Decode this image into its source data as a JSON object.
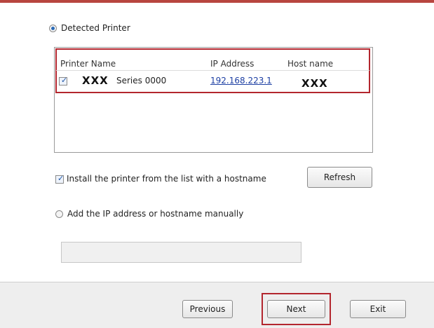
{
  "detected": {
    "label": "Detected Printer",
    "columns": {
      "name": "Printer Name",
      "ip": "IP Address",
      "host": "Host name"
    },
    "rows": [
      {
        "checked": true,
        "name_mask": "XXX",
        "series": "Series 0000",
        "ip": "192.168.223.1",
        "host": "XXX"
      }
    ]
  },
  "hostname_checkbox": {
    "checked": true,
    "label": "Install the printer from the list with a hostname"
  },
  "refresh_label": "Refresh",
  "manual": {
    "label": "Add the IP address or hostname manually",
    "value": ""
  },
  "footer": {
    "previous": "Previous",
    "next": "Next",
    "exit": "Exit"
  },
  "colors": {
    "highlight": "#b3262e",
    "link": "#1d3fa3",
    "top_bar": "#b8453f"
  }
}
